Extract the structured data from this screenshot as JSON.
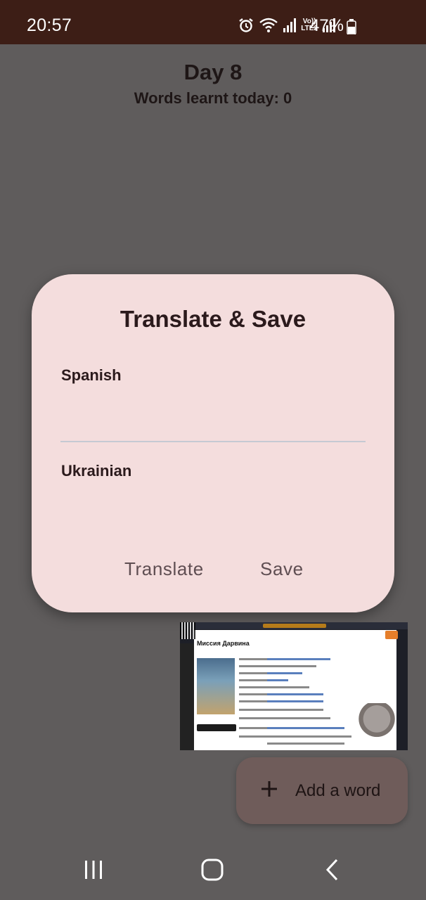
{
  "status_bar": {
    "time": "20:57",
    "network_label": "LTE2",
    "volte_label": "Vo))",
    "battery_percent": "47%",
    "icons": [
      "alarm-icon",
      "wifi-icon",
      "signal-icon",
      "volte-icon",
      "signal-icon",
      "battery-icon"
    ]
  },
  "header": {
    "day_title": "Day 8",
    "words_learnt": "Words learnt today: 0"
  },
  "dialog": {
    "title": "Translate & Save",
    "spanish_label": "Spanish",
    "spanish_value": "",
    "ukrainian_label": "Ukrainian",
    "ukrainian_value": "",
    "translate_button": "Translate",
    "save_button": "Save"
  },
  "thumbnail": {
    "page_title": "Миссия Дарвина"
  },
  "fab": {
    "label": "Add a word",
    "icon": "plus-icon"
  },
  "navbar": {
    "icons": [
      "recents-icon",
      "home-icon",
      "back-icon"
    ]
  },
  "colors": {
    "status_bar": "#3d1e16",
    "background": "#5f5c5c",
    "dialog": "#f4dddd",
    "fab": "#6f5c5a"
  }
}
